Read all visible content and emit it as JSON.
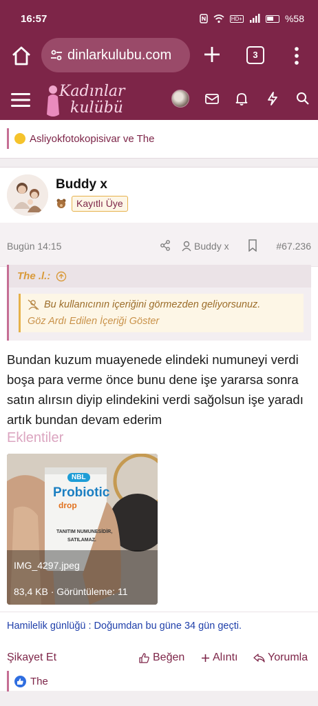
{
  "status": {
    "time": "16:57",
    "battery": "%58",
    "hd_label": "HD+"
  },
  "browser": {
    "url": "dinlarkulubu.com",
    "tab_count": "3"
  },
  "site": {
    "logo_line1": "Kadınlar",
    "logo_line2": "kulübü"
  },
  "previous_post": {
    "reactions_text": "Asliyokfotokopisivar ve The"
  },
  "post": {
    "author": "Buddy x",
    "role": "Kayıtlı Üye",
    "date": "Bugün 14:15",
    "meta_user": "Buddy x",
    "number": "#67.236",
    "quote": {
      "author": "The .l.:",
      "ignored_text": "Bu kullanıcının içeriğini görmezden geliyorsunuz.",
      "show_link": "Göz Ardı Edilen İçeriği Göster"
    },
    "body": "Bundan kuzum muayenede elindeki numuneyi verdi boşa para verme önce bunu dene işe yararsa sonra satın alırsın diyip elindekini verdi sağolsun işe yaradı artık bundan devam ederim",
    "attachments_title": "Eklentiler",
    "attachment": {
      "filename": "IMG_4297.jpeg",
      "info": "83,4 KB · Görüntüleme: 11",
      "box_brand": "NBL",
      "box_product": "Probiotic",
      "box_sub": "drop",
      "box_note1": "TANITIM NUMUNESİDİR,",
      "box_note2": "SATILAMAZ."
    },
    "signature": "Hamilelik günlüğü : Doğumdan bu güne 34 gün geçti.",
    "actions": {
      "report": "Şikayet Et",
      "like": "Beğen",
      "quote": "Alıntı",
      "reply": "Yorumla"
    },
    "likes_text": "The"
  }
}
